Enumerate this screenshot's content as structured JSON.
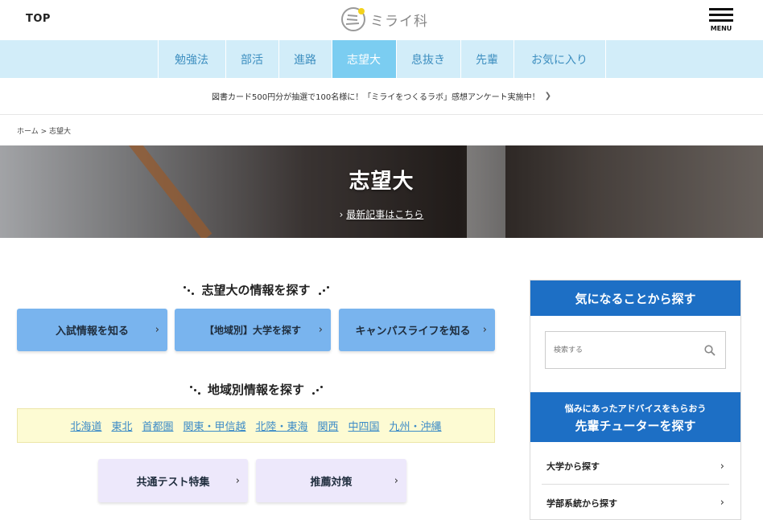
{
  "header": {
    "top_label": "TOP",
    "logo_text": "ミライ科",
    "menu_label": "MENU"
  },
  "nav": {
    "items": [
      {
        "label": "勉強法"
      },
      {
        "label": "部活"
      },
      {
        "label": "進路"
      },
      {
        "label": "志望大",
        "active": true
      },
      {
        "label": "息抜き"
      },
      {
        "label": "先輩"
      },
      {
        "label": "お気に入り"
      }
    ]
  },
  "notice": {
    "text": "図書カード500円分が抽選で100名様に！「ミライをつくるラボ」感想アンケート実施中！"
  },
  "breadcrumb": {
    "home": "ホーム",
    "sep": ">",
    "current": "志望大"
  },
  "hero": {
    "title": "志望大",
    "link": "最新記事はこちら"
  },
  "main": {
    "section1_title": "志望大の情報を探す",
    "buttons1": [
      "入試情報を知る",
      "【地域別】大学を探す",
      "キャンパスライフを知る"
    ],
    "section2_title": "地域別情報を探す",
    "regions": [
      "北海道",
      "東北",
      "首都圏",
      "関東・甲信越",
      "北陸・東海",
      "関西",
      "中四国",
      "九州・沖縄"
    ],
    "buttons2": [
      "共通テスト特集",
      "推薦対策"
    ]
  },
  "sidebar": {
    "heading1": "気になることから探す",
    "search_placeholder": "検索する",
    "heading2_line1": "悩みにあったアドバイスをもらおう",
    "heading2_line2": "先輩チューターを探す",
    "items": [
      "大学から探す",
      "学部系統から探す"
    ]
  },
  "colors": {
    "nav_bg": "#d2edf9",
    "nav_active": "#7bcdf1",
    "primary_blue": "#1d6fc5",
    "button_blue": "#79b4ee",
    "button_lilac": "#ede8fb",
    "region_bg": "#fdfbd3",
    "link_blue": "#3c8bc7"
  }
}
